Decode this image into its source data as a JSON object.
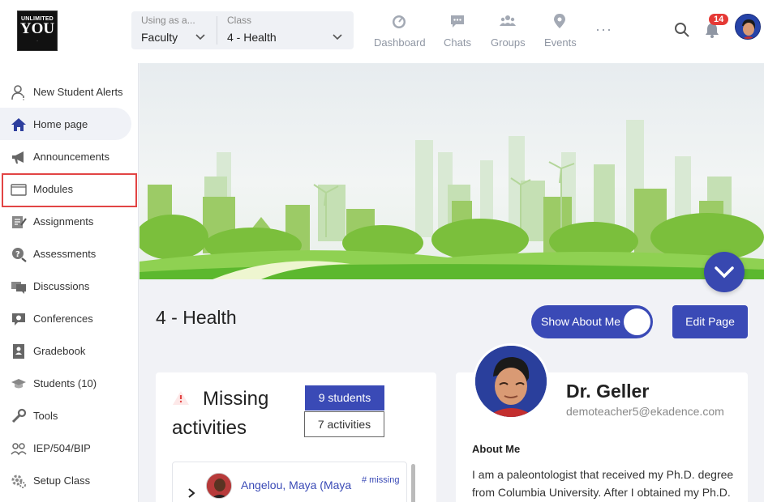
{
  "logo": {
    "line1": "UNLIMITED",
    "line2": "YOU",
    "line3": "..."
  },
  "selector": {
    "role_caption": "Using as a...",
    "role_value": "Faculty",
    "class_caption": "Class",
    "class_value": "4 - Health"
  },
  "nav": {
    "dashboard": "Dashboard",
    "chats": "Chats",
    "groups": "Groups",
    "events": "Events",
    "more": "···"
  },
  "notifications": {
    "count": "14"
  },
  "sidebar": {
    "items": [
      {
        "label": "New Student Alerts",
        "icon": "person-alert-icon"
      },
      {
        "label": "Home page",
        "icon": "home-icon"
      },
      {
        "label": "Announcements",
        "icon": "megaphone-icon"
      },
      {
        "label": "Modules",
        "icon": "folder-icon"
      },
      {
        "label": "Assignments",
        "icon": "assignment-icon"
      },
      {
        "label": "Assessments",
        "icon": "assessment-icon"
      },
      {
        "label": "Discussions",
        "icon": "discussion-icon"
      },
      {
        "label": "Conferences",
        "icon": "conference-icon"
      },
      {
        "label": "Gradebook",
        "icon": "gradebook-icon"
      },
      {
        "label": "Students (10)",
        "icon": "students-icon"
      },
      {
        "label": "Tools",
        "icon": "tools-icon"
      },
      {
        "label": "IEP/504/BIP",
        "icon": "iep-icon"
      },
      {
        "label": "Setup Class",
        "icon": "settings-gear-icon"
      }
    ]
  },
  "main": {
    "page_title": "4 - Health",
    "show_about_me": "Show About Me",
    "edit_page": "Edit Page",
    "missing": {
      "title": "Missing activities",
      "students_pill": "9 students",
      "activities_pill": "7 activities",
      "rows": [
        {
          "name": "Angelou, Maya (Maya",
          "count_label": "# missing"
        }
      ]
    },
    "profile": {
      "name": "Dr. Geller",
      "email": "demoteacher5@ekadence.com",
      "about_heading": "About Me",
      "about_text": "I am a paleontologist that received my Ph.D. degree from Columbia University. After I obtained my Ph.D."
    }
  },
  "colors": {
    "accent": "#3a4ab6",
    "highlight": "#e24444",
    "badge": "#e53935"
  }
}
